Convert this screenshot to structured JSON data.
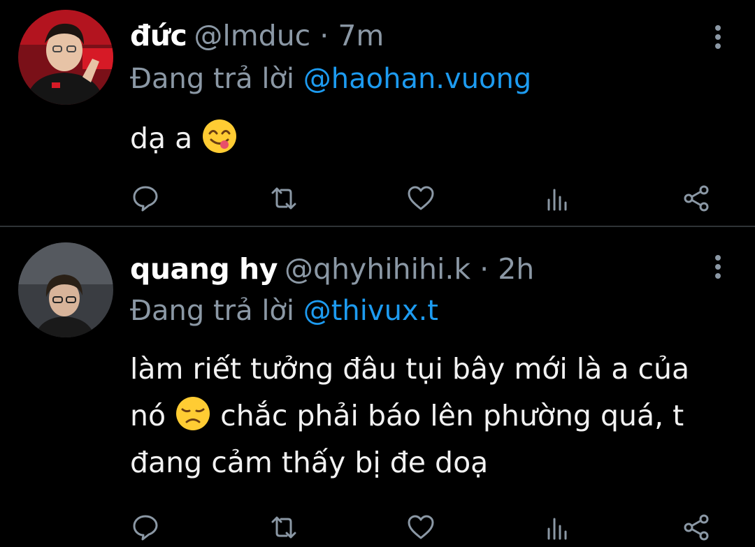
{
  "tweets": [
    {
      "name": "đức",
      "meta": "@lmduc · 7m",
      "reply_prefix": "Đang trả lời",
      "reply_to": "@haohan.vuong",
      "body_text": "dạ a",
      "emoji": "face-savoring-food-emoji"
    },
    {
      "name": "quang hy",
      "meta": "@qhyhihihi.k · 2h",
      "reply_prefix": "Đang trả lời",
      "reply_to": "@thivux.t",
      "body_before": "làm riết tưởng đâu tụi bây mới là a của nó",
      "body_after": "chắc phải báo lên phường quá, t đang cảm thấy bị đe doạ",
      "emoji": "disappointed-face-emoji"
    }
  ],
  "colors": {
    "background": "#000000",
    "muted": "#8b98a5",
    "mention": "#1d9bf0",
    "divider": "#2f3336"
  },
  "icons": [
    "reply-icon",
    "retweet-icon",
    "like-icon",
    "analytics-icon",
    "share-icon",
    "more-options-icon"
  ]
}
